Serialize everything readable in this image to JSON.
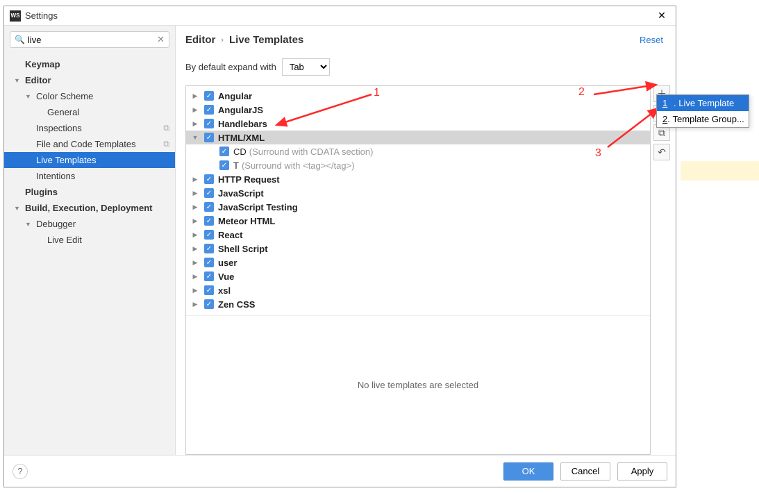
{
  "window": {
    "title": "Settings",
    "app_icon_text": "WS"
  },
  "search": {
    "placeholder": "",
    "value": "live"
  },
  "sidebar": {
    "items": [
      {
        "label": "Keymap",
        "level": 0
      },
      {
        "label": "Editor",
        "level": 0,
        "expanded": true
      },
      {
        "label": "Color Scheme",
        "level": 1,
        "expanded": true
      },
      {
        "label": "General",
        "level": 2
      },
      {
        "label": "Inspections",
        "level": 1,
        "proj": true
      },
      {
        "label": "File and Code Templates",
        "level": 1,
        "proj": true
      },
      {
        "label": "Live Templates",
        "level": 1,
        "selected": true
      },
      {
        "label": "Intentions",
        "level": 1
      },
      {
        "label": "Plugins",
        "level": 0
      },
      {
        "label": "Build, Execution, Deployment",
        "level": 0,
        "expanded": true
      },
      {
        "label": "Debugger",
        "level": 1,
        "expanded": true
      },
      {
        "label": "Live Edit",
        "level": 2
      }
    ]
  },
  "breadcrumb": {
    "parent": "Editor",
    "current": "Live Templates",
    "reset": "Reset"
  },
  "expand": {
    "label": "By default expand with",
    "value": "Tab"
  },
  "templates": [
    {
      "label": "Angular",
      "expandable": true
    },
    {
      "label": "AngularJS",
      "expandable": true
    },
    {
      "label": "Handlebars",
      "expandable": true
    },
    {
      "label": "HTML/XML",
      "expandable": true,
      "expanded": true,
      "selected": true,
      "children": [
        {
          "label": "CD",
          "hint": "(Surround with CDATA section)"
        },
        {
          "label": "T",
          "hint": "(Surround with <tag></tag>)"
        }
      ]
    },
    {
      "label": "HTTP Request",
      "expandable": true
    },
    {
      "label": "JavaScript",
      "expandable": true
    },
    {
      "label": "JavaScript Testing",
      "expandable": true
    },
    {
      "label": "Meteor HTML",
      "expandable": true
    },
    {
      "label": "React",
      "expandable": true
    },
    {
      "label": "Shell Script",
      "expandable": true
    },
    {
      "label": "user",
      "expandable": true
    },
    {
      "label": "Vue",
      "expandable": true
    },
    {
      "label": "xsl",
      "expandable": true
    },
    {
      "label": "Zen CSS",
      "expandable": true
    }
  ],
  "empty_msg": "No live templates are selected",
  "popup": {
    "items": [
      {
        "num": "1",
        "label": "Live Template",
        "selected": true
      },
      {
        "num": "2",
        "label": "Template Group..."
      }
    ]
  },
  "footer": {
    "ok": "OK",
    "cancel": "Cancel",
    "apply": "Apply"
  },
  "annotations": {
    "n1": "1",
    "n2": "2",
    "n3": "3"
  }
}
